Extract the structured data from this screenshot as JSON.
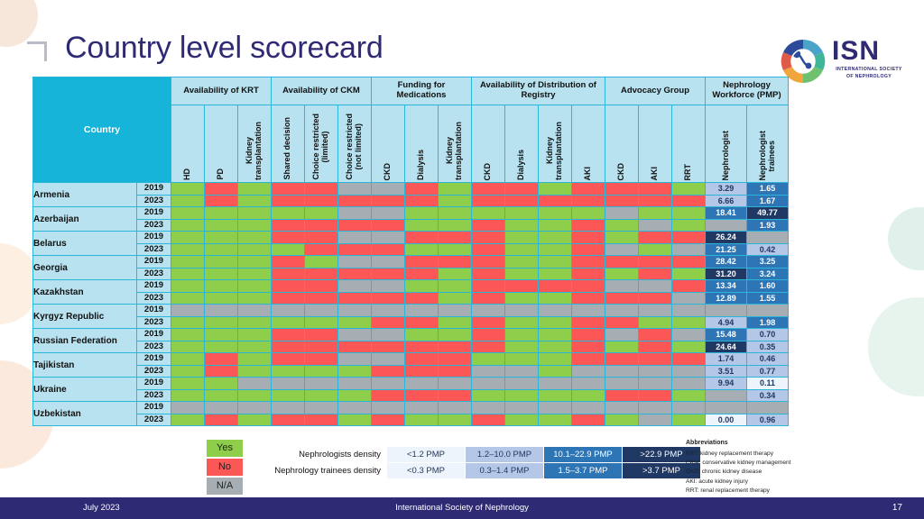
{
  "header": {
    "title": "Country level scorecard",
    "logo_word": "ISN",
    "logo_sub": "INTERNATIONAL SOCIETY OF NEPHROLOGY"
  },
  "table": {
    "country_header": "Country",
    "groups": [
      {
        "label": "Availability of KRT",
        "span": 3
      },
      {
        "label": "Availability of CKM",
        "span": 3
      },
      {
        "label": "Funding for Medications",
        "span": 3
      },
      {
        "label": "Availability of Distribution of Registry",
        "span": 4
      },
      {
        "label": "Advocacy Group",
        "span": 3
      },
      {
        "label": "Nephrology Workforce (PMP)",
        "span": 2
      }
    ],
    "subheaders": [
      "HD",
      "PD",
      "Kidney transplantation",
      "Shared decision",
      "Choice restricted (limited)",
      "Choice restricted (not limited)",
      "CKD",
      "Dialysis",
      "Kidney transplantation",
      "CKD",
      "Dialysis",
      "Kidney transplantation",
      "AKI",
      "CKD",
      "AKI",
      "RRT",
      "Nephrologist",
      "Nephrologist trainees"
    ],
    "rows": [
      {
        "country": "Armenia",
        "years": [
          {
            "year": "2019",
            "cells": [
              "yes",
              "no",
              "yes",
              "no",
              "no",
              "na",
              "na",
              "no",
              "yes",
              "no",
              "no",
              "yes",
              "no",
              "no",
              "no",
              "yes"
            ],
            "nephrologist": {
              "value": "3.29",
              "tier": "t1"
            },
            "trainees": {
              "value": "1.65",
              "tier": "t2"
            }
          },
          {
            "year": "2023",
            "cells": [
              "yes",
              "no",
              "yes",
              "no",
              "no",
              "no",
              "no",
              "no",
              "yes",
              "no",
              "no",
              "no",
              "no",
              "no",
              "no",
              "no"
            ],
            "nephrologist": {
              "value": "6.66",
              "tier": "t1"
            },
            "trainees": {
              "value": "1.67",
              "tier": "t2"
            }
          }
        ]
      },
      {
        "country": "Azerbaijan",
        "years": [
          {
            "year": "2019",
            "cells": [
              "yes",
              "yes",
              "yes",
              "yes",
              "yes",
              "na",
              "na",
              "yes",
              "yes",
              "yes",
              "yes",
              "yes",
              "yes",
              "na",
              "yes",
              "yes"
            ],
            "nephrologist": {
              "value": "18.41",
              "tier": "t2"
            },
            "trainees": {
              "value": "49.77",
              "tier": "t3"
            }
          },
          {
            "year": "2023",
            "cells": [
              "yes",
              "yes",
              "yes",
              "no",
              "no",
              "no",
              "no",
              "yes",
              "yes",
              "no",
              "yes",
              "yes",
              "no",
              "yes",
              "na",
              "yes"
            ],
            "nephrologist": {
              "value": "",
              "tier": "tna"
            },
            "trainees": {
              "value": "1.93",
              "tier": "t2"
            }
          }
        ]
      },
      {
        "country": "Belarus",
        "years": [
          {
            "year": "2019",
            "cells": [
              "yes",
              "yes",
              "yes",
              "no",
              "no",
              "na",
              "na",
              "no",
              "no",
              "no",
              "yes",
              "yes",
              "no",
              "yes",
              "no",
              "no"
            ],
            "nephrologist": {
              "value": "26.24",
              "tier": "t3"
            },
            "trainees": {
              "value": "",
              "tier": "tna"
            }
          },
          {
            "year": "2023",
            "cells": [
              "yes",
              "yes",
              "yes",
              "yes",
              "no",
              "no",
              "no",
              "yes",
              "yes",
              "no",
              "yes",
              "yes",
              "no",
              "na",
              "yes",
              "na"
            ],
            "nephrologist": {
              "value": "21.25",
              "tier": "t2"
            },
            "trainees": {
              "value": "0.42",
              "tier": "t1"
            }
          }
        ]
      },
      {
        "country": "Georgia",
        "years": [
          {
            "year": "2019",
            "cells": [
              "yes",
              "yes",
              "yes",
              "no",
              "yes",
              "na",
              "na",
              "no",
              "no",
              "no",
              "yes",
              "yes",
              "no",
              "no",
              "no",
              "no"
            ],
            "nephrologist": {
              "value": "28.42",
              "tier": "t2"
            },
            "trainees": {
              "value": "3.25",
              "tier": "t2"
            }
          },
          {
            "year": "2023",
            "cells": [
              "yes",
              "yes",
              "yes",
              "no",
              "no",
              "no",
              "no",
              "no",
              "yes",
              "no",
              "yes",
              "yes",
              "no",
              "yes",
              "no",
              "yes"
            ],
            "nephrologist": {
              "value": "31.20",
              "tier": "t3"
            },
            "trainees": {
              "value": "3.24",
              "tier": "t2"
            }
          }
        ]
      },
      {
        "country": "Kazakhstan",
        "years": [
          {
            "year": "2019",
            "cells": [
              "yes",
              "yes",
              "yes",
              "no",
              "no",
              "na",
              "na",
              "yes",
              "yes",
              "no",
              "no",
              "no",
              "no",
              "na",
              "na",
              "no"
            ],
            "nephrologist": {
              "value": "13.34",
              "tier": "t2"
            },
            "trainees": {
              "value": "1.60",
              "tier": "t2"
            }
          },
          {
            "year": "2023",
            "cells": [
              "yes",
              "yes",
              "yes",
              "no",
              "no",
              "no",
              "no",
              "no",
              "yes",
              "no",
              "yes",
              "yes",
              "no",
              "no",
              "no",
              "na"
            ],
            "nephrologist": {
              "value": "12.89",
              "tier": "t2"
            },
            "trainees": {
              "value": "1.55",
              "tier": "t2"
            }
          }
        ]
      },
      {
        "country": "Kyrgyz Republic",
        "years": [
          {
            "year": "2019",
            "cells": [
              "na",
              "na",
              "na",
              "na",
              "na",
              "na",
              "na",
              "na",
              "na",
              "na",
              "na",
              "na",
              "na",
              "na",
              "na",
              "na"
            ],
            "nephrologist": {
              "value": "",
              "tier": "tna"
            },
            "trainees": {
              "value": "",
              "tier": "tna"
            }
          },
          {
            "year": "2023",
            "cells": [
              "yes",
              "yes",
              "yes",
              "yes",
              "yes",
              "yes",
              "no",
              "no",
              "yes",
              "no",
              "yes",
              "yes",
              "no",
              "no",
              "yes",
              "yes"
            ],
            "nephrologist": {
              "value": "4.94",
              "tier": "t1"
            },
            "trainees": {
              "value": "1.98",
              "tier": "t2"
            }
          }
        ]
      },
      {
        "country": "Russian Federation",
        "years": [
          {
            "year": "2019",
            "cells": [
              "yes",
              "yes",
              "yes",
              "no",
              "no",
              "na",
              "na",
              "yes",
              "yes",
              "no",
              "yes",
              "yes",
              "no",
              "na",
              "no",
              "na"
            ],
            "nephrologist": {
              "value": "15.48",
              "tier": "t2"
            },
            "trainees": {
              "value": "0.70",
              "tier": "t1"
            }
          },
          {
            "year": "2023",
            "cells": [
              "yes",
              "yes",
              "yes",
              "no",
              "no",
              "no",
              "no",
              "no",
              "no",
              "no",
              "yes",
              "yes",
              "no",
              "yes",
              "no",
              "yes"
            ],
            "nephrologist": {
              "value": "24.64",
              "tier": "t3"
            },
            "trainees": {
              "value": "0.35",
              "tier": "t1"
            }
          }
        ]
      },
      {
        "country": "Tajikistan",
        "years": [
          {
            "year": "2019",
            "cells": [
              "yes",
              "no",
              "yes",
              "no",
              "no",
              "na",
              "na",
              "no",
              "no",
              "yes",
              "yes",
              "yes",
              "no",
              "no",
              "no",
              "no"
            ],
            "nephrologist": {
              "value": "1.74",
              "tier": "t1"
            },
            "trainees": {
              "value": "0.46",
              "tier": "t1"
            }
          },
          {
            "year": "2023",
            "cells": [
              "yes",
              "no",
              "yes",
              "yes",
              "yes",
              "yes",
              "no",
              "no",
              "no",
              "na",
              "na",
              "yes",
              "na",
              "na",
              "na",
              "na"
            ],
            "nephrologist": {
              "value": "3.51",
              "tier": "t1"
            },
            "trainees": {
              "value": "0.77",
              "tier": "t1"
            }
          }
        ]
      },
      {
        "country": "Ukraine",
        "years": [
          {
            "year": "2019",
            "cells": [
              "yes",
              "yes",
              "na",
              "na",
              "na",
              "na",
              "na",
              "na",
              "na",
              "na",
              "na",
              "na",
              "na",
              "na",
              "na",
              "na"
            ],
            "nephrologist": {
              "value": "9.94",
              "tier": "t1"
            },
            "trainees": {
              "value": "0.11",
              "tier": "t0"
            }
          },
          {
            "year": "2023",
            "cells": [
              "yes",
              "yes",
              "yes",
              "yes",
              "yes",
              "yes",
              "no",
              "no",
              "no",
              "yes",
              "yes",
              "yes",
              "yes",
              "no",
              "no",
              "yes"
            ],
            "nephrologist": {
              "value": "",
              "tier": "tna"
            },
            "trainees": {
              "value": "0.34",
              "tier": "t1"
            }
          }
        ]
      },
      {
        "country": "Uzbekistan",
        "years": [
          {
            "year": "2019",
            "cells": [
              "na",
              "na",
              "na",
              "na",
              "na",
              "na",
              "na",
              "na",
              "na",
              "na",
              "na",
              "na",
              "na",
              "na",
              "na",
              "na"
            ],
            "nephrologist": {
              "value": "",
              "tier": "tna"
            },
            "trainees": {
              "value": "",
              "tier": "tna"
            }
          },
          {
            "year": "2023",
            "cells": [
              "yes",
              "no",
              "yes",
              "no",
              "no",
              "yes",
              "no",
              "yes",
              "yes",
              "no",
              "yes",
              "yes",
              "no",
              "yes",
              "na",
              "yes"
            ],
            "nephrologist": {
              "value": "0.00",
              "tier": "t0"
            },
            "trainees": {
              "value": "0.96",
              "tier": "t1"
            }
          }
        ]
      }
    ]
  },
  "legend": {
    "key": [
      {
        "label": "Yes",
        "class": "key-yes"
      },
      {
        "label": "No",
        "class": "key-no"
      },
      {
        "label": "N/A",
        "class": "key-na"
      }
    ],
    "rows": [
      {
        "label": "Nephrologists density",
        "bands": [
          {
            "text": "<1.2 PMP",
            "tier": "t0"
          },
          {
            "text": "1.2–10.0 PMP",
            "tier": "t1"
          },
          {
            "text": "10.1–22.9 PMP",
            "tier": "t2"
          },
          {
            "text": ">22.9 PMP",
            "tier": "t3"
          }
        ]
      },
      {
        "label": "Nephrology trainees density",
        "bands": [
          {
            "text": "<0.3 PMP",
            "tier": "t0"
          },
          {
            "text": "0.3–1.4 PMP",
            "tier": "t1"
          },
          {
            "text": "1.5–3.7 PMP",
            "tier": "t2"
          },
          {
            "text": ">3.7 PMP",
            "tier": "t3"
          }
        ]
      }
    ]
  },
  "abbreviations": {
    "title": "Abbreviations",
    "items": [
      "KRT: kidney replacement therapy",
      "CKM: conservative kidney management",
      "CKD: chronic kidney disease",
      "AKI: acute kidney injury",
      "RRT: renal replacement therapy"
    ]
  },
  "footer": {
    "date": "July 2023",
    "center": "International Society of Nephrology",
    "page": "17"
  },
  "colors": {
    "yes": "#8ece4b",
    "no": "#fb5757",
    "na": "#a6aeb3",
    "header_teal": "#16b4d8",
    "header_light": "#b8e2ef",
    "brand_navy": "#2e2a73"
  }
}
